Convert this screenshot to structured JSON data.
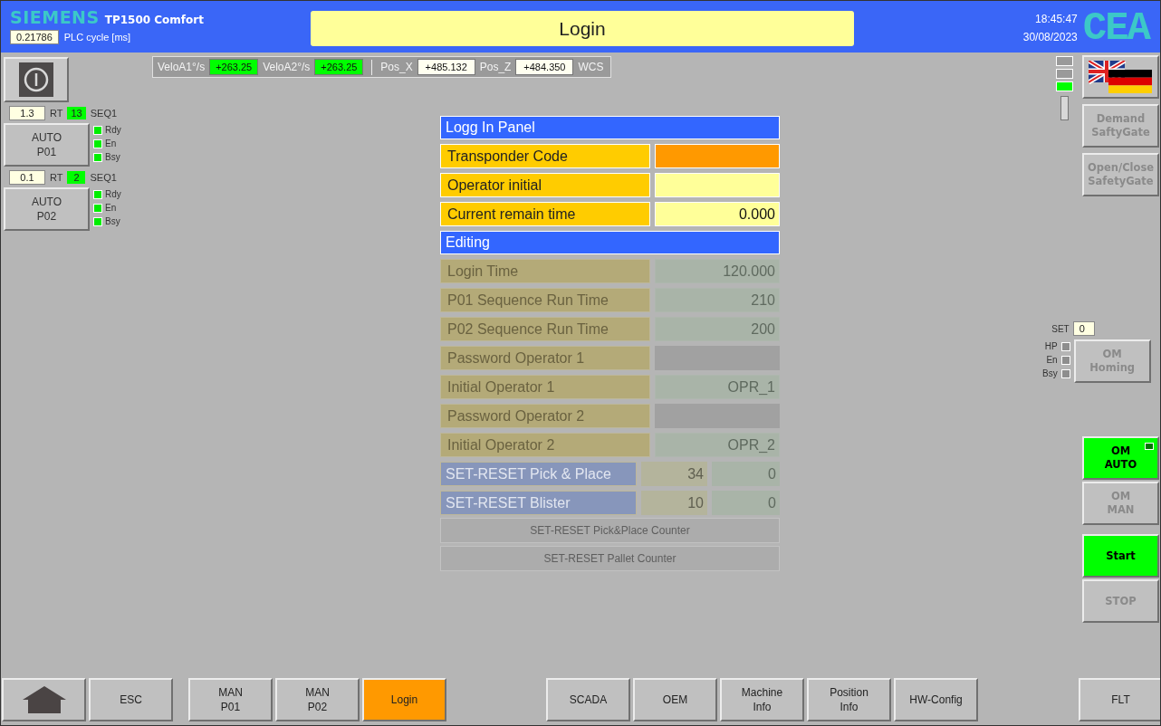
{
  "header": {
    "brand": "SIEMENS",
    "model": "TP1500 Comfort",
    "plc_cycle": {
      "value": "0.21786",
      "label": "PLC cycle [ms]"
    },
    "title": "Login",
    "time": "18:45:47",
    "date": "30/08/2023",
    "logo": "CEA"
  },
  "status_bar": {
    "items": [
      {
        "label": "VeloA1°/s",
        "value": "+263.25",
        "kind": "velocity"
      },
      {
        "label": "VeloA2°/s",
        "value": "+263.25",
        "kind": "velocity"
      },
      {
        "label": "Pos_X",
        "value": "+485.132",
        "kind": "position"
      },
      {
        "label": "Pos_Z",
        "value": "+484.350",
        "kind": "position"
      }
    ],
    "unit": "WCS"
  },
  "stations": [
    {
      "time": "1.3",
      "time_label": "RT",
      "seq_count": "13",
      "seq_label": "SEQ1",
      "button": "AUTO\nP01",
      "signals": [
        {
          "label": "Rdy",
          "on": true
        },
        {
          "label": "En",
          "on": true
        },
        {
          "label": "Bsy",
          "on": true
        }
      ]
    },
    {
      "time": "0.1",
      "time_label": "RT",
      "seq_count": "2",
      "seq_label": "SEQ1",
      "button": "AUTO\nP02",
      "signals": [
        {
          "label": "Rdy",
          "on": true
        },
        {
          "label": "En",
          "on": true
        },
        {
          "label": "Bsy",
          "on": true
        }
      ]
    }
  ],
  "login_panel": {
    "title": "Logg In Panel",
    "rows": [
      {
        "label": "Transponder Code",
        "kind": "input",
        "focused": true
      },
      {
        "label": "Operator initial",
        "kind": "input",
        "focused": false
      },
      {
        "label": "Current remain time",
        "kind": "input",
        "focused": false,
        "value": "0.000"
      }
    ]
  },
  "editing_panel": {
    "title": "Editing",
    "enabled": false,
    "rows": [
      {
        "label": "Login Time",
        "kind": "input",
        "value": "120.000"
      },
      {
        "label": "P01 Sequence Run Time",
        "kind": "input",
        "value": "210"
      },
      {
        "label": "P02 Sequence Run Time",
        "kind": "input",
        "value": "200"
      },
      {
        "label": "Password Operator 1",
        "kind": "password"
      },
      {
        "label": "Initial Operator 1",
        "kind": "input",
        "value": "OPR_1"
      },
      {
        "label": "Password Operator 2",
        "kind": "password"
      },
      {
        "label": "Initial Operator 2",
        "kind": "input",
        "value": "OPR_2"
      },
      {
        "label": "SET-RESET Pick & Place",
        "kind": "counter",
        "values": [
          "34",
          "0"
        ]
      },
      {
        "label": "SET-RESET Blister",
        "kind": "counter",
        "values": [
          "10",
          "0"
        ]
      }
    ],
    "buttons": [
      "SET-RESET Pick&Place Counter",
      "SET-RESET Pallet Counter"
    ]
  },
  "right_panel": {
    "indicators": [
      {
        "on": false
      },
      {
        "on": false
      },
      {
        "on": true
      }
    ],
    "top_buttons": [
      {
        "label": "Demand\nSaftyGate",
        "disabled": true
      },
      {
        "label": "Open/Close\nSafetyGate",
        "disabled": true
      }
    ],
    "set": {
      "label": "SET",
      "value": "0"
    },
    "homing_signals": [
      {
        "label": "HP",
        "on": false
      },
      {
        "label": "En",
        "on": false
      },
      {
        "label": "Bsy",
        "on": false
      }
    ],
    "homing_button": {
      "label": "OM\nHoming",
      "disabled": true
    },
    "mode_buttons": [
      {
        "label": "OM\nAUTO",
        "active": true,
        "disabled": false,
        "lamp": true
      },
      {
        "label": "OM\nMAN",
        "active": false,
        "disabled": true
      }
    ],
    "run_buttons": [
      {
        "label": "Start",
        "active": true,
        "disabled": false
      },
      {
        "label": "STOP",
        "active": false,
        "disabled": true
      }
    ]
  },
  "footer": {
    "groups": [
      [
        {
          "kind": "home",
          "selected": false
        },
        {
          "label": "ESC",
          "selected": false
        }
      ],
      [
        {
          "label": "MAN\nP01",
          "selected": false
        },
        {
          "label": "MAN\nP02",
          "selected": false
        },
        {
          "label": "Login",
          "selected": true
        }
      ],
      [
        {
          "label": "SCADA",
          "selected": false
        },
        {
          "label": "OEM",
          "selected": false
        },
        {
          "label": "Machine\nInfo",
          "selected": false
        },
        {
          "label": "Position\nInfo",
          "selected": false
        },
        {
          "label": "HW-Config",
          "selected": false
        }
      ],
      [
        {
          "label": "FLT",
          "selected": false
        }
      ]
    ]
  }
}
